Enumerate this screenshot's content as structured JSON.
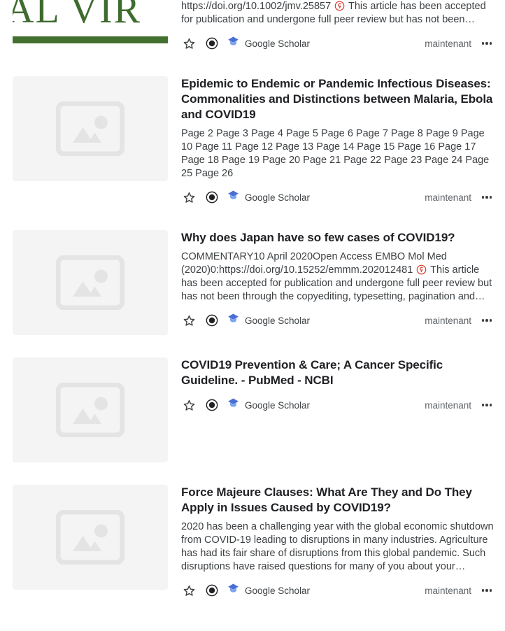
{
  "theme": {
    "background": "#ffffff",
    "title_color": "#202124",
    "snippet_color": "#3c4043",
    "meta_color": "#5f6368",
    "placeholder_bg": "#f4f4f4",
    "placeholder_glyph": "#e4e4e4",
    "scholar_cap_dark": "#4a6fd4",
    "scholar_cap_light": "#7ba3f0",
    "cite_badge_color": "#d93025",
    "cover_green": "#3e6b2e",
    "cover_bar_green": "#44702f"
  },
  "common": {
    "favorite_icon": "star-outline-icon",
    "read_status_icon": "record-circle-icon",
    "scholar_icon": "google-scholar-cap-icon",
    "scholar_label": "Google Scholar",
    "timestamp": "maintenant",
    "more_icon": "more-horizontal-icon",
    "placeholder_icon": "image-placeholder-icon"
  },
  "results": [
    {
      "thumbnail_type": "journal-cover",
      "thumbnail_text": "AL VIR",
      "title": "",
      "has_title": false,
      "snippet_before": "https://doi.org/10.1002/jmv.25857",
      "has_cite_badge": true,
      "snippet_after": "This article has been accepted for publication and undergone full peer review but has not been…",
      "scholar_label": "Google Scholar",
      "timestamp": "maintenant"
    },
    {
      "thumbnail_type": "placeholder",
      "title": "Epidemic to Endemic or Pandemic Infectious Diseases: Commonalities and Distinctions between Malaria, Ebola and COVID19",
      "has_title": true,
      "snippet_before": "Page 2 Page 3 Page 4 Page 5 Page 6 Page 7 Page 8 Page 9 Page 10 Page 11 Page 12 Page 13 Page 14 Page 15 Page 16 Page 17 Page 18 Page 19 Page 20 Page 21 Page 22 Page 23 Page 24 Page 25 Page 26",
      "has_cite_badge": false,
      "snippet_after": "",
      "scholar_label": "Google Scholar",
      "timestamp": "maintenant"
    },
    {
      "thumbnail_type": "placeholder",
      "title": "Why does Japan have so few cases of COVID19?",
      "has_title": true,
      "snippet_before": "COMMENTARY10 April 2020Open Access EMBO Mol Med (2020)0:https://doi.org/10.15252/emmm.202012481",
      "has_cite_badge": true,
      "snippet_after": "This article has been accepted for publication and undergone full peer review but has not been through the copyediting, typesetting, pagination and…",
      "scholar_label": "Google Scholar",
      "timestamp": "maintenant"
    },
    {
      "thumbnail_type": "placeholder",
      "title": "COVID19 Prevention & Care; A Cancer Specific Guideline. - PubMed - NCBI",
      "has_title": true,
      "snippet_before": "",
      "has_cite_badge": false,
      "snippet_after": "",
      "scholar_label": "Google Scholar",
      "timestamp": "maintenant"
    },
    {
      "thumbnail_type": "placeholder",
      "title": "Force Majeure Clauses: What Are They and Do They Apply in Issues Caused by COVID19?",
      "has_title": true,
      "snippet_before": "2020 has been a challenging year with the global economic shutdown from COVID-19 leading to disruptions in many industries. Agriculture has had its fair share of disruptions from this global pandemic. Such disruptions have raised questions for many of you about your…",
      "has_cite_badge": false,
      "snippet_after": "",
      "scholar_label": "Google Scholar",
      "timestamp": "maintenant"
    }
  ]
}
